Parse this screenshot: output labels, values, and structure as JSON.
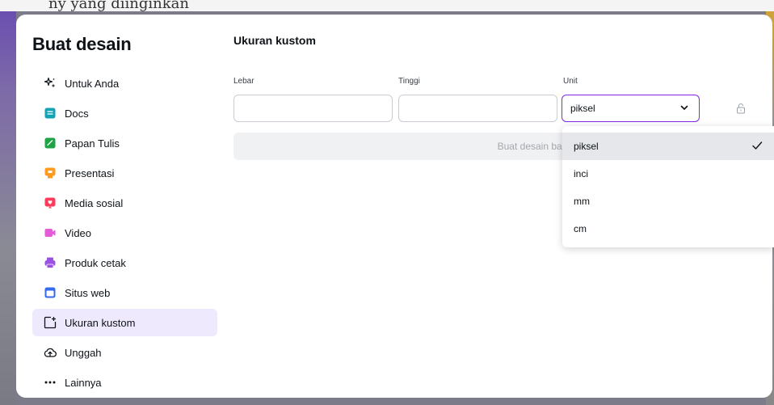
{
  "background": {
    "partial_text": "ny yang diinginkan"
  },
  "sidebar": {
    "title": "Buat desain",
    "items": [
      {
        "label": "Untuk Anda",
        "icon": "sparkle-icon",
        "color": "#0e1318",
        "active": false
      },
      {
        "label": "Docs",
        "icon": "docs-icon",
        "color": "#13a3b5",
        "active": false
      },
      {
        "label": "Papan Tulis",
        "icon": "whiteboard-icon",
        "color": "#1ea446",
        "active": false
      },
      {
        "label": "Presentasi",
        "icon": "presentation-icon",
        "color": "#ff9a1f",
        "active": false
      },
      {
        "label": "Media sosial",
        "icon": "social-media-icon",
        "color": "#ff3b5c",
        "active": false
      },
      {
        "label": "Video",
        "icon": "video-icon",
        "color": "#e45bd9",
        "active": false
      },
      {
        "label": "Produk cetak",
        "icon": "print-product-icon",
        "color": "#9b52e0",
        "active": false
      },
      {
        "label": "Situs web",
        "icon": "website-icon",
        "color": "#3469f2",
        "active": false
      },
      {
        "label": "Ukuran kustom",
        "icon": "custom-size-icon",
        "color": "#0e1318",
        "active": true
      },
      {
        "label": "Unggah",
        "icon": "upload-cloud-icon",
        "color": "#0e1318",
        "active": false
      },
      {
        "label": "Lainnya",
        "icon": "more-dots-icon",
        "color": "#0e1318",
        "active": false
      }
    ]
  },
  "main": {
    "title": "Ukuran kustom",
    "width_label": "Lebar",
    "width_value": "",
    "height_label": "Tinggi",
    "height_value": "",
    "unit_label": "Unit",
    "unit_selected": "piksel",
    "create_button_label": "Buat desain baru"
  },
  "unit_dropdown": {
    "options": [
      "piksel",
      "inci",
      "mm",
      "cm"
    ],
    "selected": "piksel"
  },
  "colors": {
    "accent": "#7d2ae8",
    "active_nav_bg": "#efe9fd"
  }
}
